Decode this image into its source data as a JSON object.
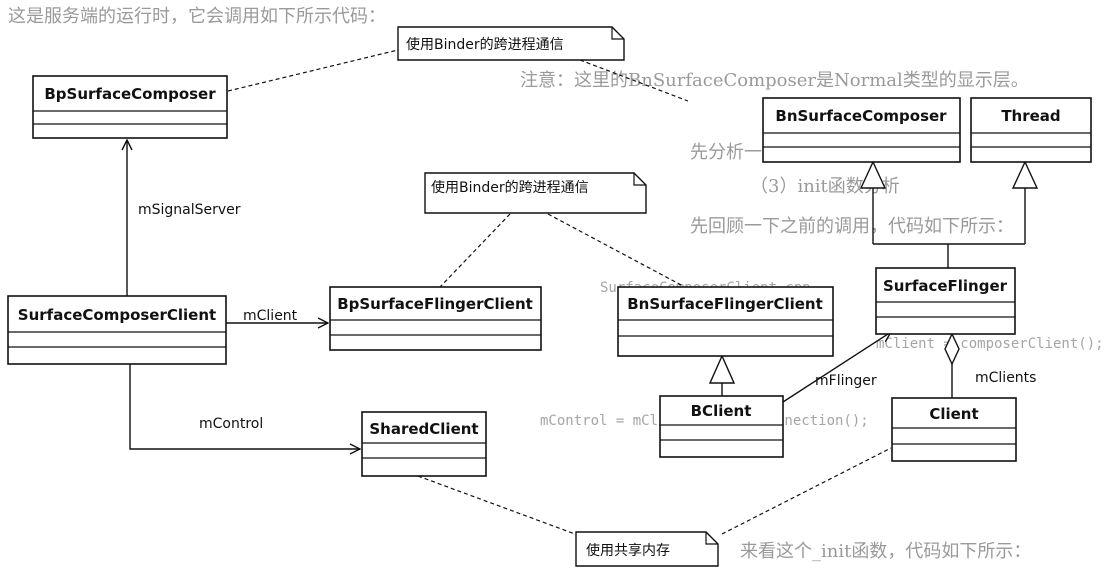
{
  "diagram": {
    "classes": [
      {
        "id": "BpSurfaceComposer",
        "name": "BpSurfaceComposer"
      },
      {
        "id": "BnSurfaceComposer",
        "name": "BnSurfaceComposer"
      },
      {
        "id": "Thread",
        "name": "Thread"
      },
      {
        "id": "SurfaceComposerClient",
        "name": "SurfaceComposerClient"
      },
      {
        "id": "BpSurfaceFlingerClient",
        "name": "BpSurfaceFlingerClient"
      },
      {
        "id": "BnSurfaceFlingerClient",
        "name": "BnSurfaceFlingerClient"
      },
      {
        "id": "SurfaceFlinger",
        "name": "SurfaceFlinger"
      },
      {
        "id": "BClient",
        "name": "BClient"
      },
      {
        "id": "Client",
        "name": "Client"
      },
      {
        "id": "SharedClient",
        "name": "SharedClient"
      }
    ],
    "notes": {
      "binder_ipc_top": "使用Binder的跨进程通信",
      "binder_ipc_mid": "使用Binder的跨进程通信",
      "shared_memory": "使用共享内存"
    },
    "associations": {
      "mSignalServer": "mSignalServer",
      "mClient": "mClient",
      "mControl": "mControl",
      "mFlinger": "mFlinger",
      "mClients": "mClients"
    }
  },
  "background_text": {
    "line1": "这是服务端的运行时，它会调用如下所示代码：",
    "line2": "注意：这里的BnSurfaceComposer是Normal类型的显示层。",
    "line3": "先分析一下构造函数，如下所示",
    "line4": "（3）init函数分析",
    "line5": "先回顾一下之前的调用，代码如下所示：",
    "line6": "SurfaceComposerClient.cpp",
    "line7": "mClient = composerClient();",
    "line8": "mControl = mClient->createConnection();",
    "line9": "来看这个_init函数，代码如下所示："
  }
}
